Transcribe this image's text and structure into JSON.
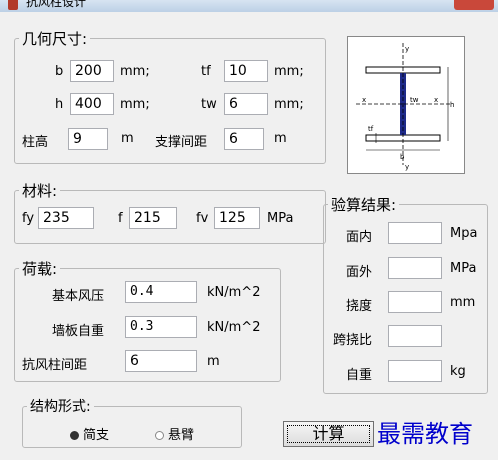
{
  "window": {
    "title": "抗风柱设计"
  },
  "geometry": {
    "legend": "几何尺寸:",
    "b_label": "b",
    "b_value": "200",
    "b_unit": "mm;",
    "tf_label": "tf",
    "tf_value": "10",
    "tf_unit": "mm;",
    "h_label": "h",
    "h_value": "400",
    "h_unit": "mm;",
    "tw_label": "tw",
    "tw_value": "6",
    "tw_unit": "mm;",
    "height_label": "柱高",
    "height_value": "9",
    "height_unit": "m",
    "brace_label": "支撑间距",
    "brace_value": "6",
    "brace_unit": "m"
  },
  "diagram": {
    "label_y_top": "y",
    "label_x_left": "x",
    "label_tw": "tw",
    "label_x_right": "x",
    "label_tf": "tf",
    "label_b": "b",
    "label_y_bottom": "y",
    "label_h": "h"
  },
  "material": {
    "legend": "材料:",
    "fy_label": "fy",
    "fy_value": "235",
    "f_label": "f",
    "f_value": "215",
    "fv_label": "fv",
    "fv_value": "125",
    "unit": "MPa"
  },
  "load": {
    "legend": "荷载:",
    "wind_label": "基本风压",
    "wind_value": "0.4",
    "wind_unit": "kN/m^2",
    "wall_label": "墙板自重",
    "wall_value": "0.3",
    "wall_unit": "kN/m^2",
    "spacing_label": "抗风柱间距",
    "spacing_value": "6",
    "spacing_unit": "m"
  },
  "results": {
    "legend": "验算结果:",
    "in_plane_label": "面内",
    "in_plane_unit": "Mpa",
    "out_plane_label": "面外",
    "out_plane_unit": "MPa",
    "deflection_label": "挠度",
    "deflection_unit": "mm",
    "span_ratio_label": "跨挠比",
    "self_weight_label": "自重",
    "self_weight_unit": "kg"
  },
  "structure": {
    "legend": "结构形式:",
    "option_simple": "简支",
    "option_cantilever": "悬臂",
    "selected": "简支"
  },
  "calc_button": {
    "label": "计算"
  },
  "watermark": {
    "text": "最需教育"
  }
}
